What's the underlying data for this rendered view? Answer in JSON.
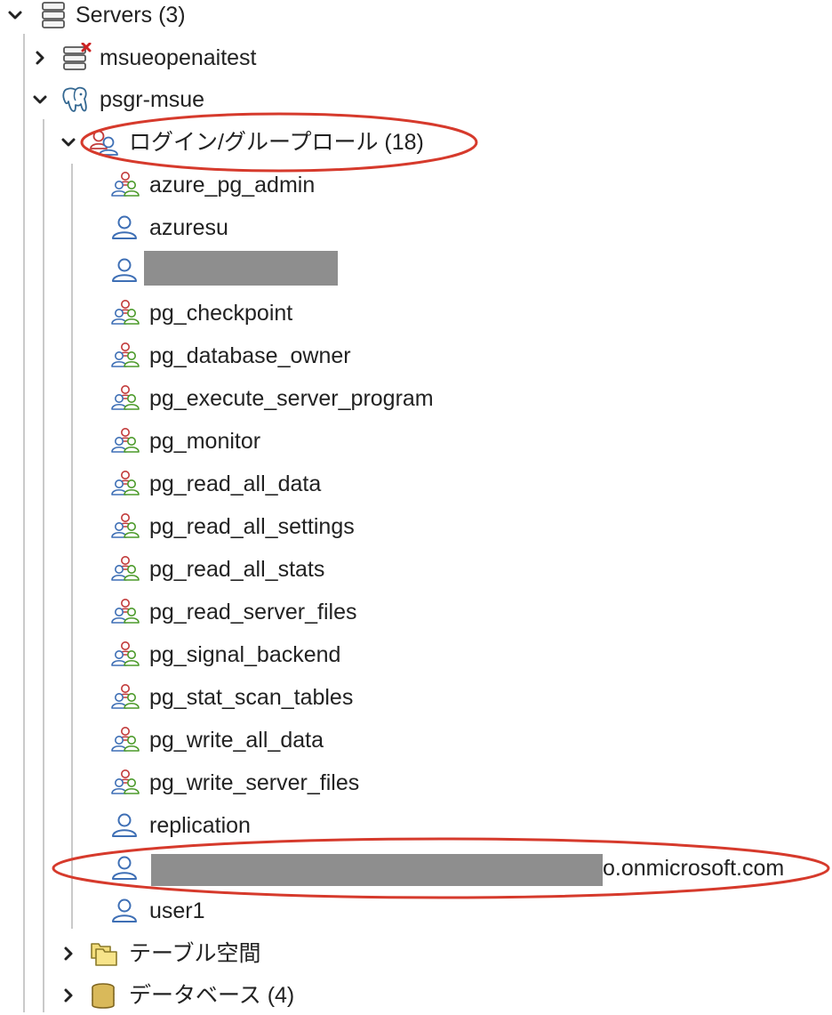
{
  "tree": {
    "servers": {
      "label": "Servers (3)"
    },
    "msueopenaitest": {
      "label": "msueopenaitest"
    },
    "psgr_msue": {
      "label": "psgr-msue"
    },
    "login_roles": {
      "label": "ログイン/グループロール (18)"
    },
    "roles": [
      {
        "label": "azure_pg_admin",
        "icon": "group-role-icon"
      },
      {
        "label": "azuresu",
        "icon": "login-role-icon"
      },
      {
        "label": "",
        "icon": "login-role-icon",
        "redacted": true
      },
      {
        "label": "pg_checkpoint",
        "icon": "group-role-icon"
      },
      {
        "label": "pg_database_owner",
        "icon": "group-role-icon"
      },
      {
        "label": "pg_execute_server_program",
        "icon": "group-role-icon"
      },
      {
        "label": "pg_monitor",
        "icon": "group-role-icon"
      },
      {
        "label": "pg_read_all_data",
        "icon": "group-role-icon"
      },
      {
        "label": "pg_read_all_settings",
        "icon": "group-role-icon"
      },
      {
        "label": "pg_read_all_stats",
        "icon": "group-role-icon"
      },
      {
        "label": "pg_read_server_files",
        "icon": "group-role-icon"
      },
      {
        "label": "pg_signal_backend",
        "icon": "group-role-icon"
      },
      {
        "label": "pg_stat_scan_tables",
        "icon": "group-role-icon"
      },
      {
        "label": "pg_write_all_data",
        "icon": "group-role-icon"
      },
      {
        "label": "pg_write_server_files",
        "icon": "group-role-icon"
      },
      {
        "label": "replication",
        "icon": "login-role-icon"
      },
      {
        "label": "o.onmicrosoft.com",
        "icon": "login-role-icon",
        "redacted": true
      },
      {
        "label": "user1",
        "icon": "login-role-icon"
      }
    ],
    "tablespaces": {
      "label": "テーブル空間"
    },
    "databases": {
      "label": "データベース (4)"
    }
  },
  "colors": {
    "annotation": "#d63a2c",
    "redaction": "#8e8e8e",
    "role_blue": "#3e6fb5",
    "role_green": "#4c9a2a",
    "role_red": "#c23b3b"
  }
}
